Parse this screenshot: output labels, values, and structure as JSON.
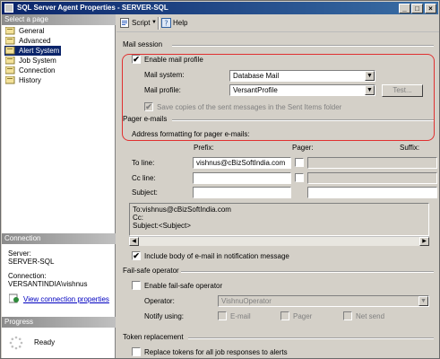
{
  "window": {
    "title": "SQL Server Agent Properties - SERVER-SQL",
    "controls": [
      "_",
      "□",
      "×"
    ]
  },
  "left": {
    "select_page_header": "Select a page",
    "pages": [
      {
        "label": "General",
        "selected": false
      },
      {
        "label": "Advanced",
        "selected": false
      },
      {
        "label": "Alert System",
        "selected": true
      },
      {
        "label": "Job System",
        "selected": false
      },
      {
        "label": "Connection",
        "selected": false
      },
      {
        "label": "History",
        "selected": false
      }
    ],
    "connection_header": "Connection",
    "server_label": "Server:",
    "server_value": "SERVER-SQL",
    "connection_label": "Connection:",
    "connection_value": "VERSANTINDIA\\vishnus",
    "view_link": "View connection properties",
    "progress_header": "Progress",
    "progress_status": "Ready"
  },
  "toolbar": {
    "script_label": "Script",
    "help_label": "Help"
  },
  "mail": {
    "section": "Mail session",
    "enable_label": "Enable mail profile",
    "enable_checked": true,
    "system_label": "Mail system:",
    "system_value": "Database Mail",
    "profile_label": "Mail profile:",
    "profile_value": "VersantProfile",
    "test_button": "Test...",
    "save_copies_label": "Save copies of the sent messages in the Sent Items folder",
    "save_copies_checked": true
  },
  "pager": {
    "section": "Pager e-mails",
    "address_formatting": "Address formatting for pager e-mails:",
    "col_prefix": "Prefix:",
    "col_pager": "Pager:",
    "col_suffix": "Suffix:",
    "to_label": "To line:",
    "to_prefix": "vishnus@cBizSoftIndia.com",
    "cc_label": "Cc line:",
    "subject_label": "Subject:",
    "preview_text": "To:vishnus@cBizSoftIndia.com\nCc:\nSubject:<Subject>",
    "include_body_label": "Include body of e-mail in notification message",
    "include_body_checked": true
  },
  "failsafe": {
    "section": "Fail-safe operator",
    "enable_label": "Enable fail-safe operator",
    "enable_checked": false,
    "operator_label": "Operator:",
    "operator_value": "VishnuOperator",
    "notify_label": "Notify using:",
    "email_label": "E-mail",
    "pager_label": "Pager",
    "netsend_label": "Net send"
  },
  "token": {
    "section": "Token replacement",
    "replace_label": "Replace tokens for all job responses to alerts",
    "replace_checked": false
  }
}
